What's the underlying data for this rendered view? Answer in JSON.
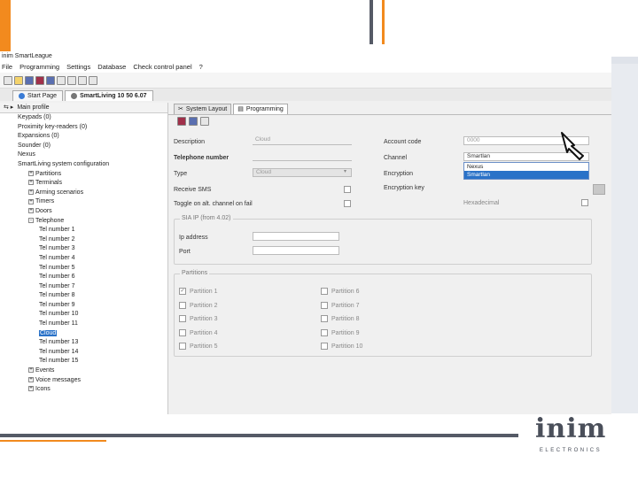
{
  "app": {
    "title": "inim SmartLeague",
    "menu": [
      "File",
      "Programming",
      "Settings",
      "Database",
      "Check control panel",
      "?"
    ],
    "tabs": [
      {
        "label": "Start Page",
        "active": false
      },
      {
        "label": "SmartLiving 10 50 6.07",
        "active": true
      }
    ]
  },
  "tree": {
    "header": "Main profile",
    "items": [
      {
        "label": "Keypads (0)",
        "indent": 1,
        "expander": ""
      },
      {
        "label": "Proximity key-readers (0)",
        "indent": 1,
        "expander": ""
      },
      {
        "label": "Expansions (0)",
        "indent": 1,
        "expander": ""
      },
      {
        "label": "Sounder (0)",
        "indent": 1,
        "expander": ""
      },
      {
        "label": "Nexus",
        "indent": 1,
        "expander": ""
      },
      {
        "label": "SmartLiving system configuration",
        "indent": 1,
        "expander": ""
      },
      {
        "label": "Partitions",
        "indent": 2,
        "expander": "+"
      },
      {
        "label": "Terminals",
        "indent": 2,
        "expander": "+"
      },
      {
        "label": "Arming scenarios",
        "indent": 2,
        "expander": "+"
      },
      {
        "label": "Timers",
        "indent": 2,
        "expander": "+"
      },
      {
        "label": "Doors",
        "indent": 2,
        "expander": "+"
      },
      {
        "label": "Telephone",
        "indent": 2,
        "expander": "-"
      },
      {
        "label": "Tel number 1",
        "indent": 3,
        "expander": ""
      },
      {
        "label": "Tel number 2",
        "indent": 3,
        "expander": ""
      },
      {
        "label": "Tel number 3",
        "indent": 3,
        "expander": ""
      },
      {
        "label": "Tel number 4",
        "indent": 3,
        "expander": ""
      },
      {
        "label": "Tel number 5",
        "indent": 3,
        "expander": ""
      },
      {
        "label": "Tel number 6",
        "indent": 3,
        "expander": ""
      },
      {
        "label": "Tel number 7",
        "indent": 3,
        "expander": ""
      },
      {
        "label": "Tel number 8",
        "indent": 3,
        "expander": ""
      },
      {
        "label": "Tel number 9",
        "indent": 3,
        "expander": ""
      },
      {
        "label": "Tel number 10",
        "indent": 3,
        "expander": ""
      },
      {
        "label": "Tel number 11",
        "indent": 3,
        "expander": ""
      },
      {
        "label": "Cloud",
        "indent": 3,
        "expander": "",
        "selected": true
      },
      {
        "label": "Tel number 13",
        "indent": 3,
        "expander": ""
      },
      {
        "label": "Tel number 14",
        "indent": 3,
        "expander": ""
      },
      {
        "label": "Tel number 15",
        "indent": 3,
        "expander": ""
      },
      {
        "label": "Events",
        "indent": 2,
        "expander": "+"
      },
      {
        "label": "Voice messages",
        "indent": 2,
        "expander": "+"
      },
      {
        "label": "Icons",
        "indent": 2,
        "expander": "+"
      }
    ]
  },
  "main": {
    "subtabs": [
      {
        "label": "System Layout",
        "active": false
      },
      {
        "label": "Programming",
        "active": true
      }
    ],
    "left_form": {
      "description_label": "Description",
      "description_value": "Cloud",
      "telephone_label": "Telephone number",
      "type_label": "Type",
      "type_value": "Cloud",
      "receive_sms_label": "Receive SMS",
      "toggle_label": "Toggle on alt. channel on fail"
    },
    "right_form": {
      "account_code_label": "Account code",
      "account_code_value": "0000",
      "channel_label": "Channel",
      "channel_value": "Smartlan",
      "channel_options": [
        "Nexus",
        "Smartlan"
      ],
      "channel_selected": "Smartlan",
      "encryption_label": "Encryption",
      "encryption_key_label": "Encryption key",
      "hexadecimal_label": "Hexadecimal"
    },
    "sia_group": {
      "title": "SIA IP (from 4.02)",
      "ip_label": "Ip address",
      "port_label": "Port"
    },
    "partitions_group": {
      "title": "Partitions",
      "items": [
        {
          "label": "Partition 1",
          "checked": true
        },
        {
          "label": "Partition 2",
          "checked": false
        },
        {
          "label": "Partition 3",
          "checked": false
        },
        {
          "label": "Partition 4",
          "checked": false
        },
        {
          "label": "Partition 5",
          "checked": false
        },
        {
          "label": "Partition 6",
          "checked": false
        },
        {
          "label": "Partition 7",
          "checked": false
        },
        {
          "label": "Partition 8",
          "checked": false
        },
        {
          "label": "Partition 9",
          "checked": false
        },
        {
          "label": "Partition 10",
          "checked": false
        }
      ]
    }
  },
  "logo": {
    "name": "inim",
    "sub": "ELECTRONICS"
  },
  "colors": {
    "accent": "#f28a1e",
    "dark": "#555a66",
    "selection": "#2a72c8"
  }
}
